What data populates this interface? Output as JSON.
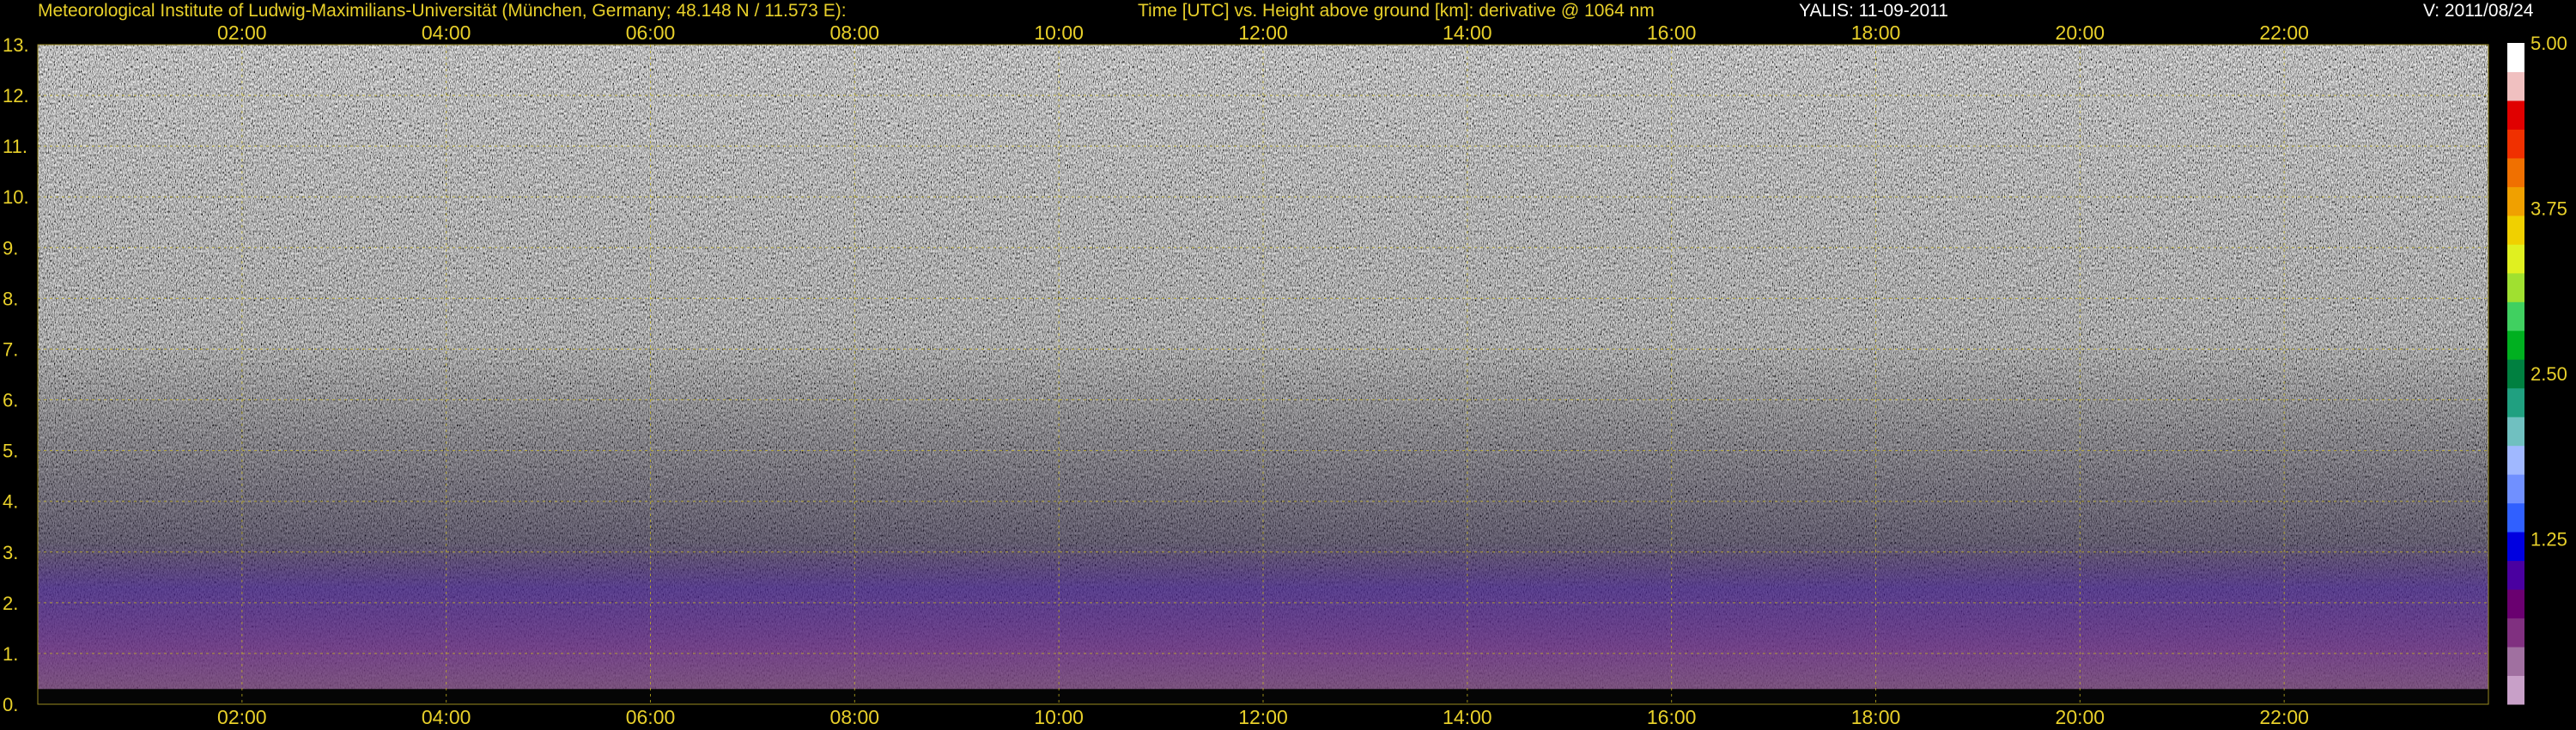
{
  "header": {
    "institute": "Meteorological Institute of Ludwig-Maximilians-Universität (München, Germany; 48.148 N / 11.573 E):",
    "axes_description": "Time [UTC] vs. Height above ground [km]: derivative @ 1064 nm",
    "instrument": "YALIS: 11-09-2011",
    "version": "V: 2011/08/24"
  },
  "chart_data": {
    "type": "heatmap",
    "title": "Time [UTC] vs. Height above ground [km]: derivative @ 1064 nm",
    "xlabel": "Time [UTC]",
    "ylabel": "Height above ground [km]",
    "x_range": [
      "00:00",
      "24:00"
    ],
    "x_tick_labels": [
      "02:00",
      "04:00",
      "06:00",
      "08:00",
      "10:00",
      "12:00",
      "14:00",
      "16:00",
      "18:00",
      "20:00",
      "22:00"
    ],
    "ylim": [
      0,
      13
    ],
    "y_tick_labels": [
      "0.",
      "1.",
      "2.",
      "3.",
      "4.",
      "5.",
      "6.",
      "7.",
      "8.",
      "9.",
      "10.",
      "11.",
      "12.",
      "13."
    ],
    "grid": true,
    "colorbar": {
      "range": [
        0,
        5
      ],
      "tick_labels": [
        "1.25",
        "2.50",
        "3.75",
        "5.00"
      ],
      "colors": [
        "#c8a0c8",
        "#a070a0",
        "#803080",
        "#6a0070",
        "#4a00a0",
        "#0000e0",
        "#3060ff",
        "#7090ff",
        "#a0b8ff",
        "#70c0c0",
        "#20a080",
        "#008040",
        "#00b020",
        "#40d060",
        "#a0e030",
        "#e0f020",
        "#f0d000",
        "#f0a000",
        "#f07000",
        "#f03000",
        "#e00000",
        "#f0c0c0",
        "#ffffff"
      ]
    }
  }
}
